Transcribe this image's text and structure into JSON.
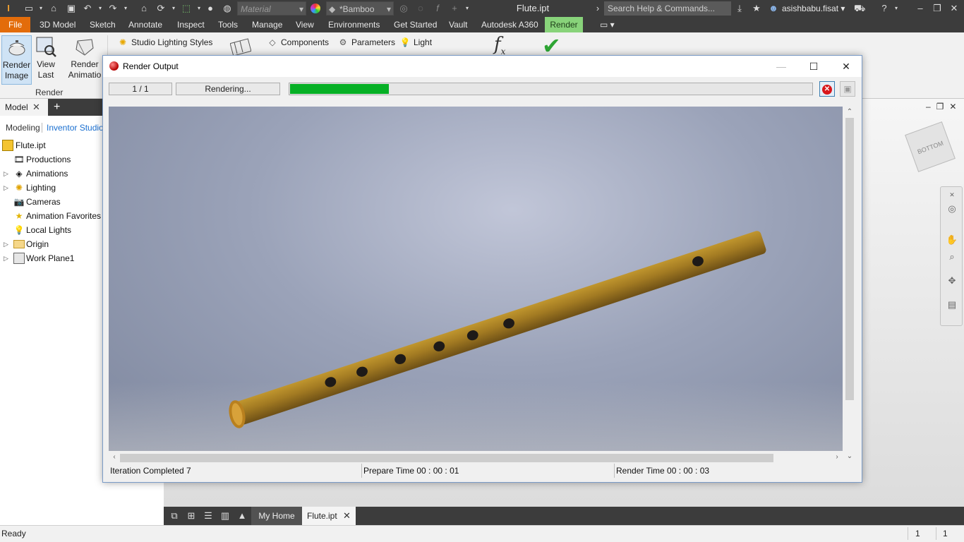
{
  "titlebar": {
    "material_placeholder": "Material",
    "appearance_value": "*Bamboo",
    "document_title": "Flute.ipt",
    "search_placeholder": "Search Help & Commands...",
    "user_name": "asishbabu.fisat"
  },
  "menu": {
    "tabs": [
      "File",
      "3D Model",
      "Sketch",
      "Annotate",
      "Inspect",
      "Tools",
      "Manage",
      "View",
      "Environments",
      "Get Started",
      "Vault",
      "Autodesk A360",
      "Render"
    ],
    "active_tab": "Render"
  },
  "ribbon": {
    "render_image": [
      "Render",
      "Image"
    ],
    "view_last": [
      "View",
      "Last"
    ],
    "render_animation": [
      "Render",
      "Animatio"
    ],
    "panel_label": "Render",
    "studio_lighting_styles": "Studio Lighting Styles",
    "components": "Components",
    "parameters": "Parameters",
    "light": "Light"
  },
  "browser": {
    "model_tab": "Model",
    "modes": [
      "Modeling",
      "Inventor Studio"
    ],
    "tree": [
      {
        "label": "Flute.ipt",
        "icon": "part-icon"
      },
      {
        "label": "Productions",
        "icon": "productions-icon"
      },
      {
        "label": "Animations",
        "icon": "animations-icon"
      },
      {
        "label": "Lighting",
        "icon": "lighting-icon"
      },
      {
        "label": "Cameras",
        "icon": "camera-icon"
      },
      {
        "label": "Animation Favorites",
        "icon": "star-icon"
      },
      {
        "label": "Local Lights",
        "icon": "lightbulb-icon"
      },
      {
        "label": "Origin",
        "icon": "folder-icon"
      },
      {
        "label": "Work Plane1",
        "icon": "plane-icon"
      }
    ]
  },
  "render_dialog": {
    "title": "Render Output",
    "iteration": "1 / 1",
    "status": "Rendering...",
    "progress": 0.19,
    "progress_color": "#06b025",
    "iteration_completed": "Iteration Completed  7",
    "prepare_time": "Prepare Time  00 : 00 : 01",
    "render_time": "Render Time  00 : 00 : 03"
  },
  "flute": {
    "holes": 7,
    "body_color": "#a07a2a",
    "hole_color": "#1e1a18"
  },
  "graphics": {
    "viewcube_face": "BOTTOM"
  },
  "doc_tabs": {
    "home": "My Home",
    "file": "Flute.ipt"
  },
  "status": {
    "text": "Ready",
    "count1": "1",
    "count2": "1"
  },
  "colors": {
    "file_tab": "#e36c0a",
    "active_tab": "#88d37a",
    "dark_chrome": "#3c3c3c"
  }
}
